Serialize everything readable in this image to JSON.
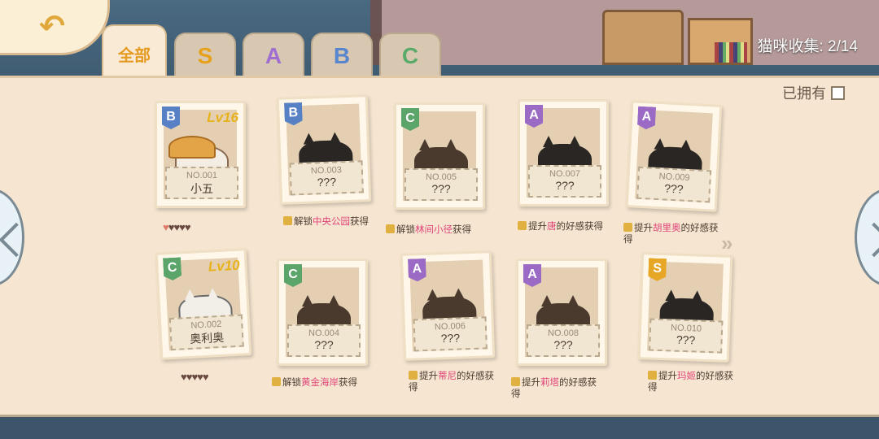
{
  "header": {
    "collection_text": "猫咪收集: 2/14"
  },
  "tabs": [
    {
      "label": "全部"
    },
    {
      "label": "S"
    },
    {
      "label": "A"
    },
    {
      "label": "B"
    },
    {
      "label": "C"
    }
  ],
  "filter": {
    "owned_label": "已拥有"
  },
  "colors": {
    "tab_S": "#e7a21d",
    "tab_A": "#a06dd0",
    "tab_B": "#5786cf",
    "tab_C": "#5aaa6a"
  },
  "cards": [
    {
      "rank": "B",
      "level": "Lv16",
      "no": "NO.001",
      "name": "小五",
      "hearts_filled": 1,
      "hearts_total": 5
    },
    {
      "rank": "B",
      "no": "NO.003",
      "name": "???",
      "unlock_prefix": "解锁",
      "unlock_place": "中央公园",
      "unlock_suffix": "获得"
    },
    {
      "rank": "C",
      "no": "NO.005",
      "name": "???",
      "unlock_prefix": "解锁",
      "unlock_place": "林间小径",
      "unlock_suffix": "获得"
    },
    {
      "rank": "A",
      "no": "NO.007",
      "name": "???",
      "unlock_prefix": "提升",
      "unlock_place": "唐",
      "unlock_suffix": "的好感获得"
    },
    {
      "rank": "A",
      "no": "NO.009",
      "name": "???",
      "unlock_prefix": "提升",
      "unlock_place": "胡里奥",
      "unlock_suffix": "的好感获得"
    },
    {
      "rank": "C",
      "level": "Lv10",
      "no": "NO.002",
      "name": "奥利奥",
      "hearts_filled": 0,
      "hearts_total": 5
    },
    {
      "rank": "C",
      "no": "NO.004",
      "name": "???",
      "unlock_prefix": "解锁",
      "unlock_place": "黄金海岸",
      "unlock_suffix": "获得"
    },
    {
      "rank": "A",
      "no": "NO.006",
      "name": "???",
      "unlock_prefix": "提升",
      "unlock_place": "蒂尼",
      "unlock_suffix": "的好感获得"
    },
    {
      "rank": "A",
      "no": "NO.008",
      "name": "???",
      "unlock_prefix": "提升",
      "unlock_place": "莉塔",
      "unlock_suffix": "的好感获得"
    },
    {
      "rank": "S",
      "no": "NO.010",
      "name": "???",
      "unlock_prefix": "提升",
      "unlock_place": "玛姬",
      "unlock_suffix": "的好感获得"
    }
  ]
}
